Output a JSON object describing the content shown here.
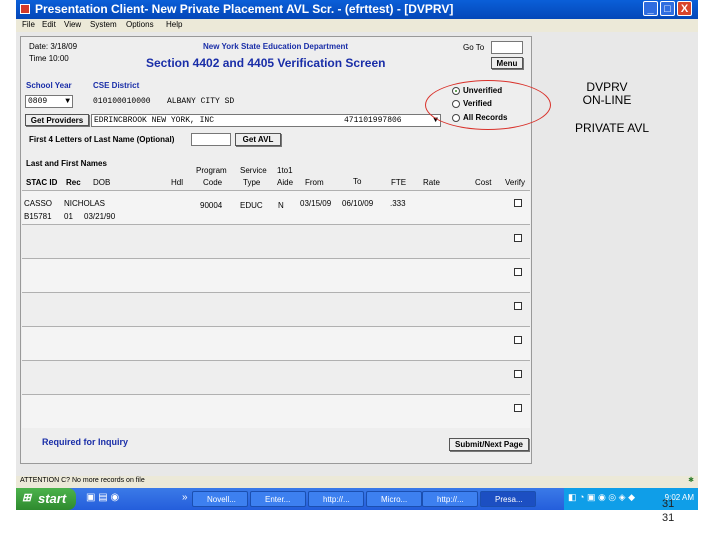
{
  "window": {
    "title": "Presentation Client- New Private Placement AVL Scr. - (efrttest) - [DVPRV]",
    "buttons": [
      "_",
      "□",
      "X"
    ]
  },
  "menu": [
    "File",
    "Edit",
    "View",
    "System",
    "Options",
    "Help"
  ],
  "header": {
    "date_label": "Date: 3/18/09",
    "time_label": "Time 10:00",
    "department": "New York State Education Department",
    "screen_title": "Section 4402 and 4405 Verification Screen",
    "goto_label": "Go To",
    "menu_button": "Menu"
  },
  "form": {
    "school_year_label": "School Year",
    "school_year_value": "0809",
    "cse_district_label": "CSE District",
    "cse_district_code": "010100010000",
    "cse_district_name": "ALBANY CITY SD",
    "get_providers_button": "Get Providers",
    "provider_name": "EDRINCBROOK NEW YORK, INC",
    "provider_code": "471101997806",
    "last_name_label": "First 4 Letters of Last Name (Optional)",
    "get_avl_button": "Get AVL"
  },
  "filter": {
    "options": [
      {
        "label": "Unverified",
        "selected": true
      },
      {
        "label": "Verified",
        "selected": false
      },
      {
        "label": "All Records",
        "selected": false
      }
    ]
  },
  "notes": {
    "line1": "DVPRV",
    "line2": "ON-LINE",
    "line3": "PRIVATE AVL"
  },
  "table": {
    "header_top": {
      "last_first": "Last and First Names",
      "program": "Program",
      "service": "Service",
      "one_to_one": "1to1"
    },
    "columns": [
      "STAC ID",
      "Rec",
      "DOB",
      "Hdl",
      "Code",
      "Type",
      "Aide",
      "From",
      "To",
      "FTE",
      "Rate",
      "Cost",
      "Verify"
    ],
    "record": {
      "last_name": "CASSO",
      "first_name": "NICHOLAS",
      "stac_id": "B15781",
      "rec": "01",
      "dob": "03/21/90",
      "code": "90004",
      "type": "EDUC",
      "aide": "N",
      "from": "03/15/09",
      "to": "06/10/09",
      "fte": ".333"
    }
  },
  "footer": {
    "required_label": "Required for Inquiry",
    "submit_button": "Submit/Next Page",
    "status_text": "ATTENTION    C? No more records on file"
  },
  "taskbar": {
    "start": "start",
    "tasks": [
      "Novell...",
      "Enter...",
      "http://...",
      "Micro...",
      "http://...",
      "Presa..."
    ],
    "clock": "9:02 AM"
  },
  "page_number": "31",
  "page_number_small": "31"
}
